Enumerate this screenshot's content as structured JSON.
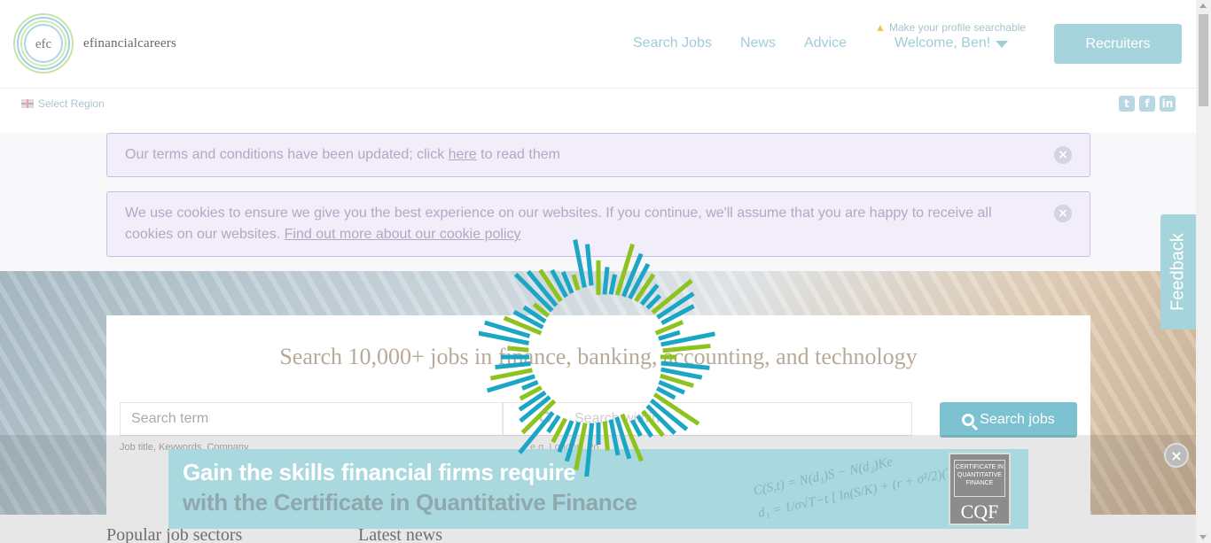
{
  "header": {
    "logo_mark": "efc",
    "logo_text": "efinancialcareers",
    "nav": [
      "Search Jobs",
      "News",
      "Advice"
    ],
    "profile_hint": "Make your profile searchable",
    "welcome": "Welcome, Ben!",
    "recruiters": "Recruiters"
  },
  "subheader": {
    "region": "Select Region",
    "socials": [
      "twitter-icon",
      "facebook-icon",
      "linkedin-icon"
    ]
  },
  "notices": {
    "terms_before": "Our terms and conditions have been updated; click ",
    "terms_link": "here",
    "terms_after": " to read them",
    "cookie_text": "We use cookies to ensure we give you the best experience on our websites. If you continue, we'll assume that you are happy to receive all cookies on our websites. ",
    "cookie_link": "Find out more about our cookie policy"
  },
  "search": {
    "title": "Search 10,000+ jobs in finance, banking, accounting, and technology",
    "term_placeholder": "Search term",
    "term_hint": "Job title, Keywords, Company",
    "location_placeholder": "Search within",
    "location_hint": "e.g. London, Po",
    "button": "Search jobs"
  },
  "sections": {
    "popular": "Popular job sectors",
    "news": "Latest news"
  },
  "ad": {
    "line1": "Gain the skills financial firms require",
    "line2": "with the Certificate in Quantitative Finance",
    "cqf_small": "CERTIFICATE IN QUANTITATIVE FINANCE",
    "cqf": "CQF"
  },
  "feedback": "Feedback",
  "colors": {
    "accent": "#a6d4dc",
    "spinner_blue": "#1aa6c4",
    "spinner_green": "#8dc21f",
    "notice_bg": "#f1edf9"
  }
}
